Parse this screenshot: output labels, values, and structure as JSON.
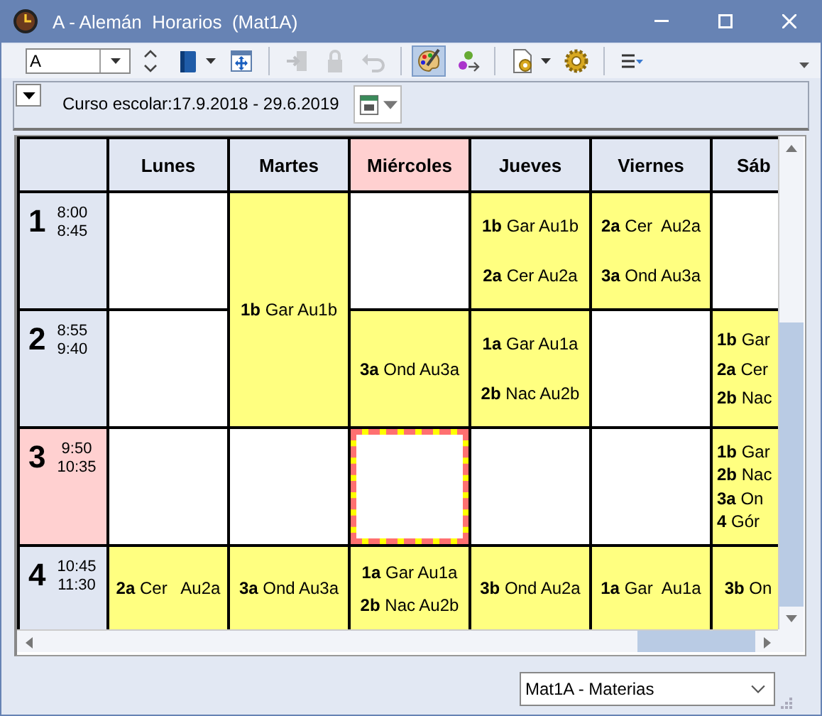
{
  "window": {
    "title": "A - Alemán  Horarios  (Mat1A)"
  },
  "toolbar": [
    {
      "kind": "combo",
      "value": "A"
    },
    {
      "kind": "spinner"
    },
    {
      "kind": "button",
      "disabled": false,
      "pressed": false,
      "dropdown": true
    },
    {
      "kind": "button",
      "disabled": false,
      "pressed": false,
      "dropdown": false
    },
    {
      "kind": "separator"
    },
    {
      "kind": "button",
      "disabled": true,
      "pressed": false,
      "dropdown": false
    },
    {
      "kind": "button",
      "disabled": true,
      "pressed": false,
      "dropdown": false
    },
    {
      "kind": "button",
      "disabled": true,
      "pressed": false,
      "dropdown": false
    },
    {
      "kind": "separator"
    },
    {
      "kind": "button",
      "disabled": false,
      "pressed": true,
      "dropdown": false
    },
    {
      "kind": "button",
      "disabled": false,
      "pressed": false,
      "dropdown": false
    },
    {
      "kind": "separator"
    },
    {
      "kind": "button",
      "disabled": false,
      "pressed": false,
      "dropdown": true
    },
    {
      "kind": "button",
      "disabled": false,
      "pressed": false,
      "dropdown": false
    },
    {
      "kind": "separator"
    },
    {
      "kind": "button",
      "disabled": false,
      "pressed": false,
      "dropdown": false
    }
  ],
  "period_bar": {
    "text": "Curso escolar:17.9.2018 - 29.6.2019"
  },
  "timetable": {
    "days": [
      {
        "label": "Lunes",
        "today": false
      },
      {
        "label": "Martes",
        "today": false
      },
      {
        "label": "Miércoles",
        "today": true
      },
      {
        "label": "Jueves",
        "today": false
      },
      {
        "label": "Viernes",
        "today": false
      },
      {
        "label": "Sáb",
        "today": false
      }
    ],
    "periods": [
      {
        "number": "1",
        "start": "8:00",
        "end": "8:45",
        "current": false,
        "cells": [
          {
            "kind": "single",
            "selected": false
          },
          {
            "kind": "double",
            "selected": false,
            "lessons": [
              {
                "class": "1b",
                "text": "Gar Au1b"
              }
            ]
          },
          {
            "kind": "single",
            "selected": false
          },
          {
            "kind": "single",
            "selected": false,
            "lessons": [
              {
                "class": "1b",
                "text": "Gar Au1b"
              },
              {
                "class": "2a",
                "text": "Cer Au2a"
              }
            ]
          },
          {
            "kind": "single",
            "selected": false,
            "lessons": [
              {
                "class": "2a",
                "text": "Cer  Au2a"
              },
              {
                "class": "3a",
                "text": "Ond Au3a"
              }
            ]
          },
          {
            "kind": "single",
            "selected": false
          }
        ]
      },
      {
        "number": "2",
        "start": "8:55",
        "end": "9:40",
        "current": false,
        "cells": [
          {
            "kind": "single",
            "selected": false
          },
          {
            "kind": "single",
            "selected": false,
            "lessons": [
              {
                "class": "3a",
                "text": "Ond Au3a"
              }
            ]
          },
          {
            "kind": "single",
            "selected": false,
            "lessons": [
              {
                "class": "1a",
                "text": "Gar Au1a"
              },
              {
                "class": "2b",
                "text": "Nac Au2b"
              }
            ]
          },
          {
            "kind": "single",
            "selected": false
          },
          {
            "kind": "single",
            "selected": false,
            "lessons": [
              {
                "class": "1b",
                "text": "Gar"
              },
              {
                "class": "2a",
                "text": "Cer"
              },
              {
                "class": "2b",
                "text": "Nac"
              }
            ]
          }
        ]
      },
      {
        "number": "3",
        "start": "9:50",
        "end": "10:35",
        "current": true,
        "cells": [
          {
            "kind": "single",
            "selected": false
          },
          {
            "kind": "single",
            "selected": false
          },
          {
            "kind": "single",
            "selected": true
          },
          {
            "kind": "single",
            "selected": false
          },
          {
            "kind": "single",
            "selected": false
          },
          {
            "kind": "single",
            "selected": false,
            "lessons": [
              {
                "class": "1b",
                "text": "Gar"
              },
              {
                "class": "2b",
                "text": "Nac"
              },
              {
                "class": "3a",
                "text": "On"
              },
              {
                "class": "4",
                "text": "Gór"
              }
            ]
          }
        ]
      },
      {
        "number": "4",
        "start": "10:45",
        "end": "11:30",
        "current": false,
        "cells": [
          {
            "kind": "single",
            "selected": false,
            "lessons": [
              {
                "class": "2a",
                "text": "Cer   Au2a"
              }
            ]
          },
          {
            "kind": "single",
            "selected": false,
            "lessons": [
              {
                "class": "3a",
                "text": "Ond Au3a"
              }
            ]
          },
          {
            "kind": "single",
            "selected": false,
            "lessons": [
              {
                "class": "1a",
                "text": "Gar Au1a"
              },
              {
                "class": "2b",
                "text": "Nac Au2b"
              }
            ]
          },
          {
            "kind": "single",
            "selected": false,
            "lessons": [
              {
                "class": "3b",
                "text": "Ond Au2a"
              }
            ]
          },
          {
            "kind": "single",
            "selected": false,
            "lessons": [
              {
                "class": "1a",
                "text": "Gar  Au1a"
              }
            ]
          },
          {
            "kind": "single",
            "selected": false,
            "lessons": [
              {
                "class": "3b",
                "text": "On"
              }
            ]
          }
        ]
      }
    ]
  },
  "footer": {
    "view_select": "Mat1A - Materias"
  }
}
